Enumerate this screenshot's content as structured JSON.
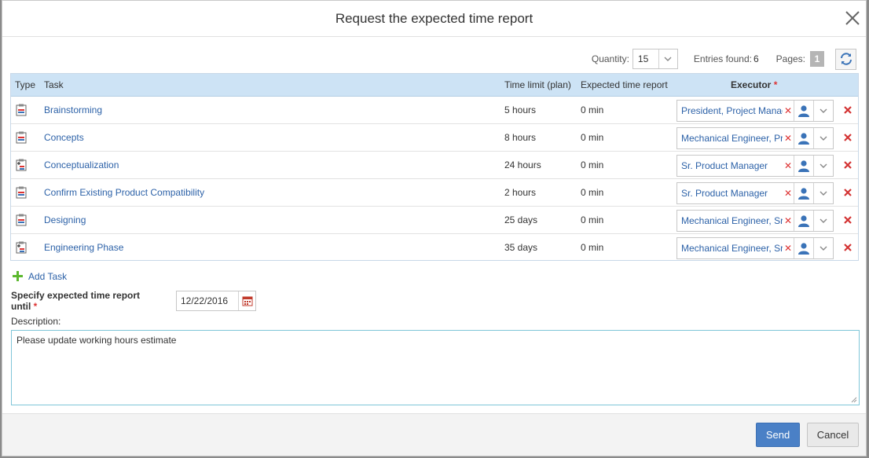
{
  "dialog": {
    "title": "Request the expected time report"
  },
  "toolbar": {
    "quantity_label": "Quantity:",
    "quantity_value": "15",
    "entries_label": "Entries found:",
    "entries_value": "6",
    "pages_label": "Pages:",
    "page_value": "1"
  },
  "grid": {
    "headers": {
      "type": "Type",
      "task": "Task",
      "time_limit": "Time limit (plan)",
      "expected": "Expected time report",
      "executor": "Executor",
      "required_mark": "*"
    },
    "rows": [
      {
        "type_icon": "task-icon",
        "task": "Brainstorming",
        "limit": "5 hours",
        "expected": "0 min",
        "executor": "President, Project Manager"
      },
      {
        "type_icon": "task-icon",
        "task": "Concepts",
        "limit": "8 hours",
        "expected": "0 min",
        "executor": "Mechanical Engineer, Product"
      },
      {
        "type_icon": "phase-icon",
        "task": "Conceptualization",
        "limit": "24 hours",
        "expected": "0 min",
        "executor": "Sr. Product Manager"
      },
      {
        "type_icon": "task-icon",
        "task": "Confirm Existing Product Compatibility",
        "limit": "2 hours",
        "expected": "0 min",
        "executor": "Sr. Product Manager"
      },
      {
        "type_icon": "task-icon",
        "task": "Designing",
        "limit": "25 days",
        "expected": "0 min",
        "executor": "Mechanical Engineer, Sr."
      },
      {
        "type_icon": "phase-icon",
        "task": "Engineering Phase",
        "limit": "35 days",
        "expected": "0 min",
        "executor": "Mechanical Engineer, Sr."
      }
    ]
  },
  "add_task": {
    "label": "Add Task"
  },
  "form": {
    "until_label": "Specify expected time report until",
    "required_mark": "*",
    "date_value": "12/22/2016",
    "description_label": "Description:",
    "description_value": "Please update working hours estimate"
  },
  "footer": {
    "send_label": "Send",
    "cancel_label": "Cancel"
  },
  "colors": {
    "header_bg": "#cde3f5",
    "link": "#2d62a8",
    "delete": "#d33333",
    "primary_button": "#4a80c6",
    "add_icon": "#5cb82e"
  }
}
